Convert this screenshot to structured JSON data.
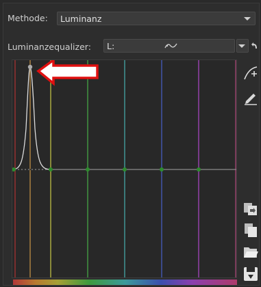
{
  "method": {
    "label": "Methode:",
    "value": "Luminanz"
  },
  "equalizer": {
    "label": "Luminanzequalizer:",
    "channel": "L:"
  },
  "icons": {
    "curve_edit": "curve-edit-icon",
    "pencil": "pencil-icon",
    "copy": "copy-icon",
    "paste": "paste-icon",
    "open": "folder-open-icon",
    "save": "save-icon",
    "reset": "reset-icon",
    "wave": "wave-icon"
  },
  "colors": {
    "accent_red": "#e01010",
    "node_green": "#2e8b2e",
    "curve": "#dddddd"
  }
}
